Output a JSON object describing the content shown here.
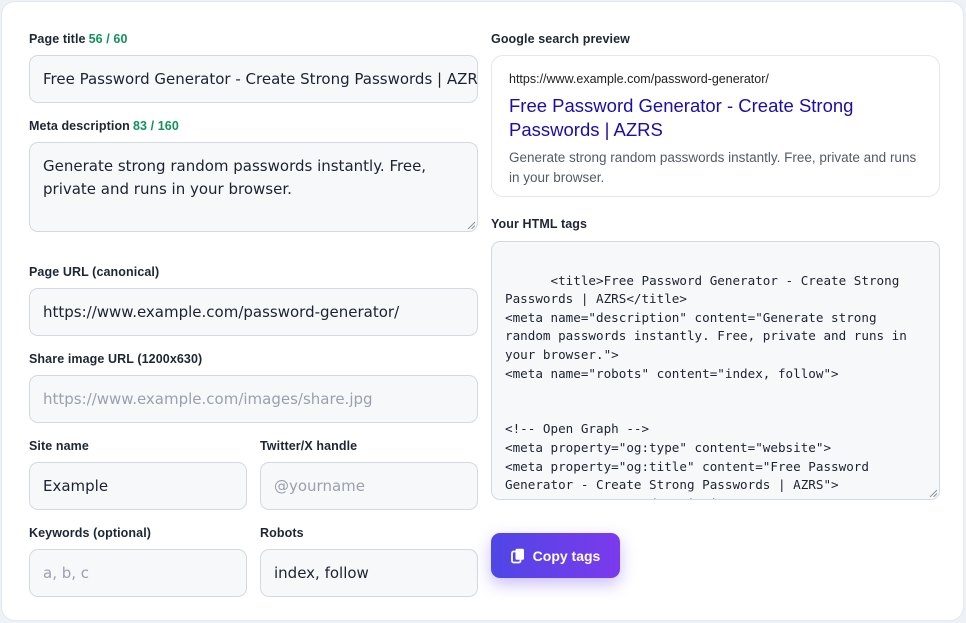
{
  "form": {
    "page_title_label": "Page title",
    "page_title_counter": "56 / 60",
    "page_title_value": "Free Password Generator - Create Strong Passwords | AZRS",
    "meta_desc_label": "Meta description",
    "meta_desc_counter": "83 / 160",
    "meta_desc_value": "Generate strong random passwords instantly. Free, private and runs in your browser.",
    "page_url_label": "Page URL (canonical)",
    "page_url_value": "https://www.example.com/password-generator/",
    "share_image_label": "Share image URL (1200x630)",
    "share_image_placeholder": "https://www.example.com/images/share.jpg",
    "site_name_label": "Site name",
    "site_name_value": "Example",
    "twitter_label": "Twitter/X handle",
    "twitter_placeholder": "@yourname",
    "keywords_label": "Keywords (optional)",
    "keywords_placeholder": "a, b, c",
    "robots_label": "Robots",
    "robots_value": "index, follow"
  },
  "preview": {
    "label": "Google search preview",
    "url": "https://www.example.com/password-generator/",
    "title": "Free Password Generator - Create Strong Passwords | AZRS",
    "description": "Generate strong random passwords instantly. Free, private and runs in your browser."
  },
  "html_tags": {
    "label": "Your HTML tags",
    "code": "<title>Free Password Generator - Create Strong Passwords | AZRS</title>\n<meta name=\"description\" content=\"Generate strong random passwords instantly. Free, private and runs in your browser.\">\n<meta name=\"robots\" content=\"index, follow\">\n\n\n<!-- Open Graph -->\n<meta property=\"og:type\" content=\"website\">\n<meta property=\"og:title\" content=\"Free Password Generator - Create Strong Passwords | AZRS\">\n<meta property=\"og:description\" content=\"Generate strong random passwords instantly. Free, private and runs in your browser.\">"
  },
  "actions": {
    "copy_label": "Copy tags"
  },
  "colors": {
    "counter": "#12925a",
    "preview_title": "#1a0dab",
    "button_start": "#4f46e5",
    "button_end": "#7c3aed"
  },
  "icons": {
    "copy": "copy-icon",
    "resize": "resize-grip-icon"
  }
}
